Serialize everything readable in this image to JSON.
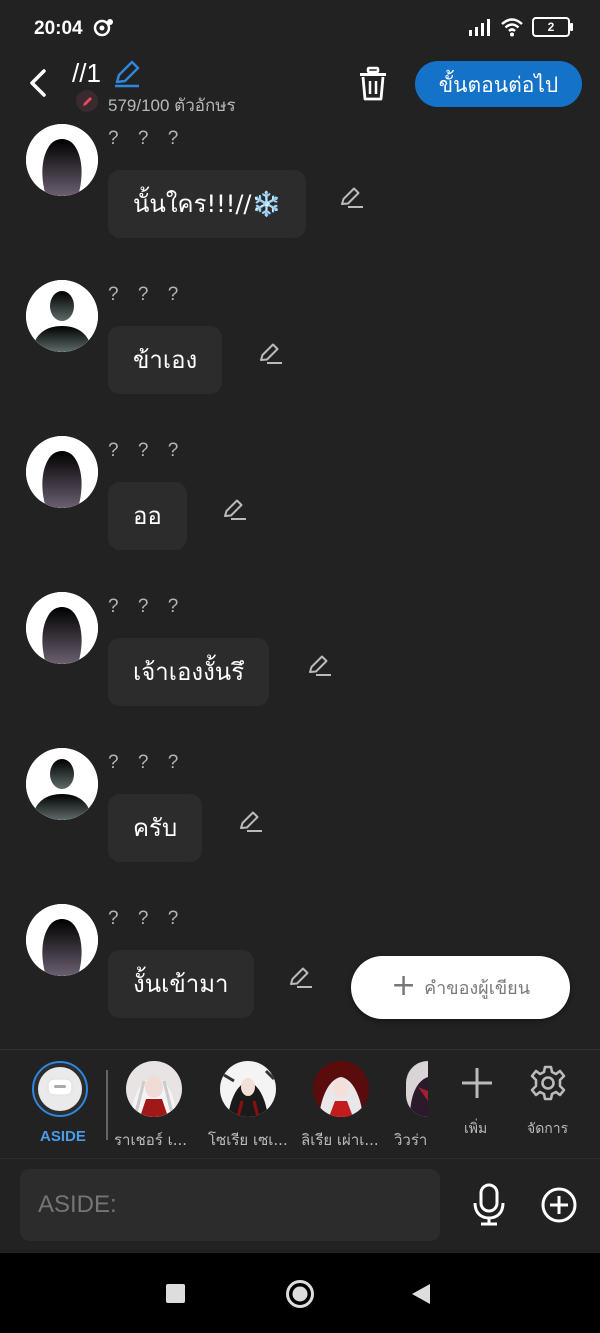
{
  "status": {
    "time": "20:04",
    "battery": "2"
  },
  "header": {
    "title": "//1",
    "char_count": "579/100 ตัวอักษร",
    "next_label": "ขั้นตอนต่อไป"
  },
  "messages": [
    {
      "name": "? ? ?",
      "text": "นั้นใคร!!!//❄️"
    },
    {
      "name": "? ? ?",
      "text": "ข้าเอง"
    },
    {
      "name": "? ? ?",
      "text": "ออ"
    },
    {
      "name": "? ? ?",
      "text": "เจ้าเองงั้นรึ"
    },
    {
      "name": "? ? ?",
      "text": "ครับ"
    },
    {
      "name": "? ? ?",
      "text": "งั้นเข้ามา"
    }
  ],
  "fab": {
    "label": "คำของผู้เขียน"
  },
  "charbar": {
    "aside_label": "ASIDE",
    "characters": [
      {
        "label": "ราเชอร์ เ..."
      },
      {
        "label": "โซเรีย เซเ..."
      },
      {
        "label": "ลิเรีย เผ่าเ..."
      },
      {
        "label": "วิวร่า"
      }
    ],
    "add_label": "เพิ่ม",
    "manage_label": "จัดการ"
  },
  "input": {
    "placeholder": "ASIDE:"
  },
  "colors": {
    "accent": "#1473c8",
    "aside_ring": "#2e86de",
    "background": "#222222",
    "bubble": "#2c2c2c"
  }
}
